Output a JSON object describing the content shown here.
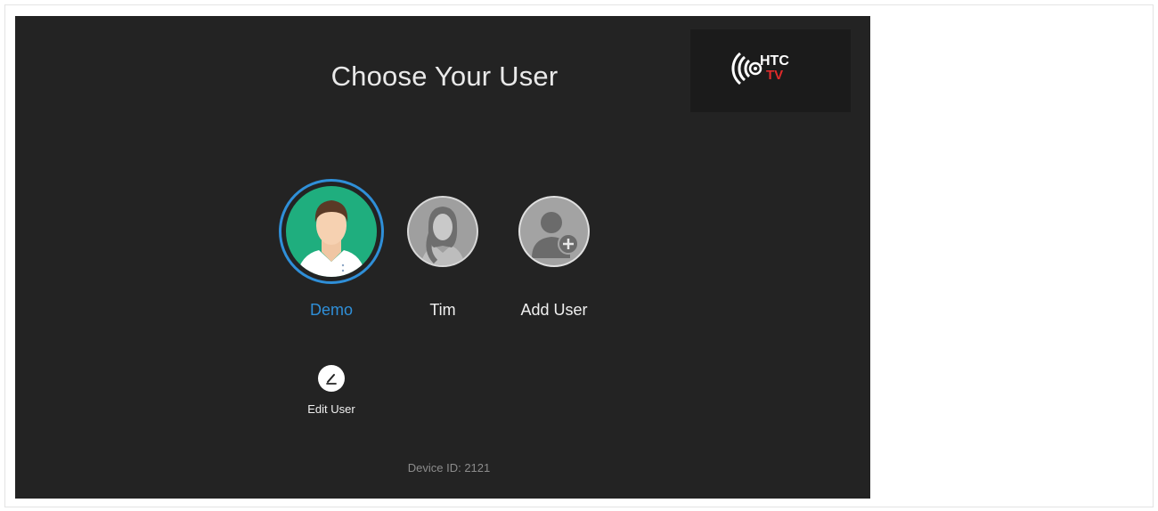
{
  "screen": {
    "title": "Choose Your User",
    "background_color": "#232323"
  },
  "brand": {
    "logo_icon": "htc-tv-logo",
    "logo_text_top": "HTC",
    "logo_text_bottom": "TV",
    "logo_accent_color": "#e02a2a"
  },
  "users": [
    {
      "name": "Demo",
      "avatar_icon": "male-avatar-icon",
      "selected": true,
      "accent_color": "#2f8fd8"
    },
    {
      "name": "Tim",
      "avatar_icon": "female-avatar-icon",
      "selected": false
    },
    {
      "name": "Add User",
      "avatar_icon": "add-user-icon",
      "selected": false
    }
  ],
  "edit": {
    "label": "Edit User",
    "icon": "pencil-icon"
  },
  "footer": {
    "device_id": "Device ID: 2121"
  }
}
